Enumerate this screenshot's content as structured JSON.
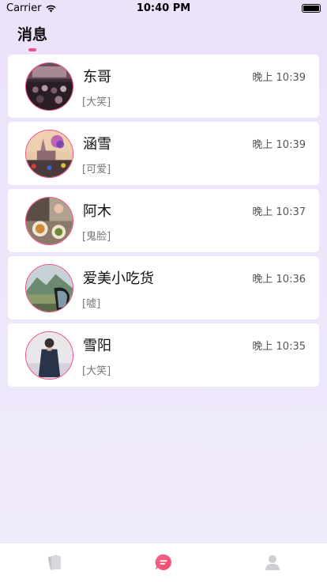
{
  "status_bar": {
    "carrier": "Carrier",
    "time": "10:40 PM"
  },
  "header": {
    "title": "消息"
  },
  "messages": [
    {
      "name": "东哥",
      "time": "晚上 10:39",
      "preview": "[大笑]",
      "avatar": "concert-crowd-photo"
    },
    {
      "name": "涵雪",
      "time": "晚上 10:39",
      "preview": "[可爱]",
      "avatar": "castle-fireworks-photo"
    },
    {
      "name": "阿木",
      "time": "晚上 10:37",
      "preview": "[鬼脸]",
      "avatar": "food-table-photo"
    },
    {
      "name": "爱美小吃货",
      "time": "晚上 10:36",
      "preview": "[嘘]",
      "avatar": "mountain-car-mirror-photo"
    },
    {
      "name": "雪阳",
      "time": "晚上 10:35",
      "preview": "[大笑]",
      "avatar": "person-in-coat-photo"
    }
  ],
  "tab_bar": {
    "tabs": [
      {
        "icon": "cards-icon",
        "active": false
      },
      {
        "icon": "chat-bubble-icon",
        "active": true
      },
      {
        "icon": "profile-icon",
        "active": false
      }
    ]
  },
  "colors": {
    "accent": "#f0508c",
    "avatar_border": "#ef4c82",
    "background": "#ede6fb"
  }
}
